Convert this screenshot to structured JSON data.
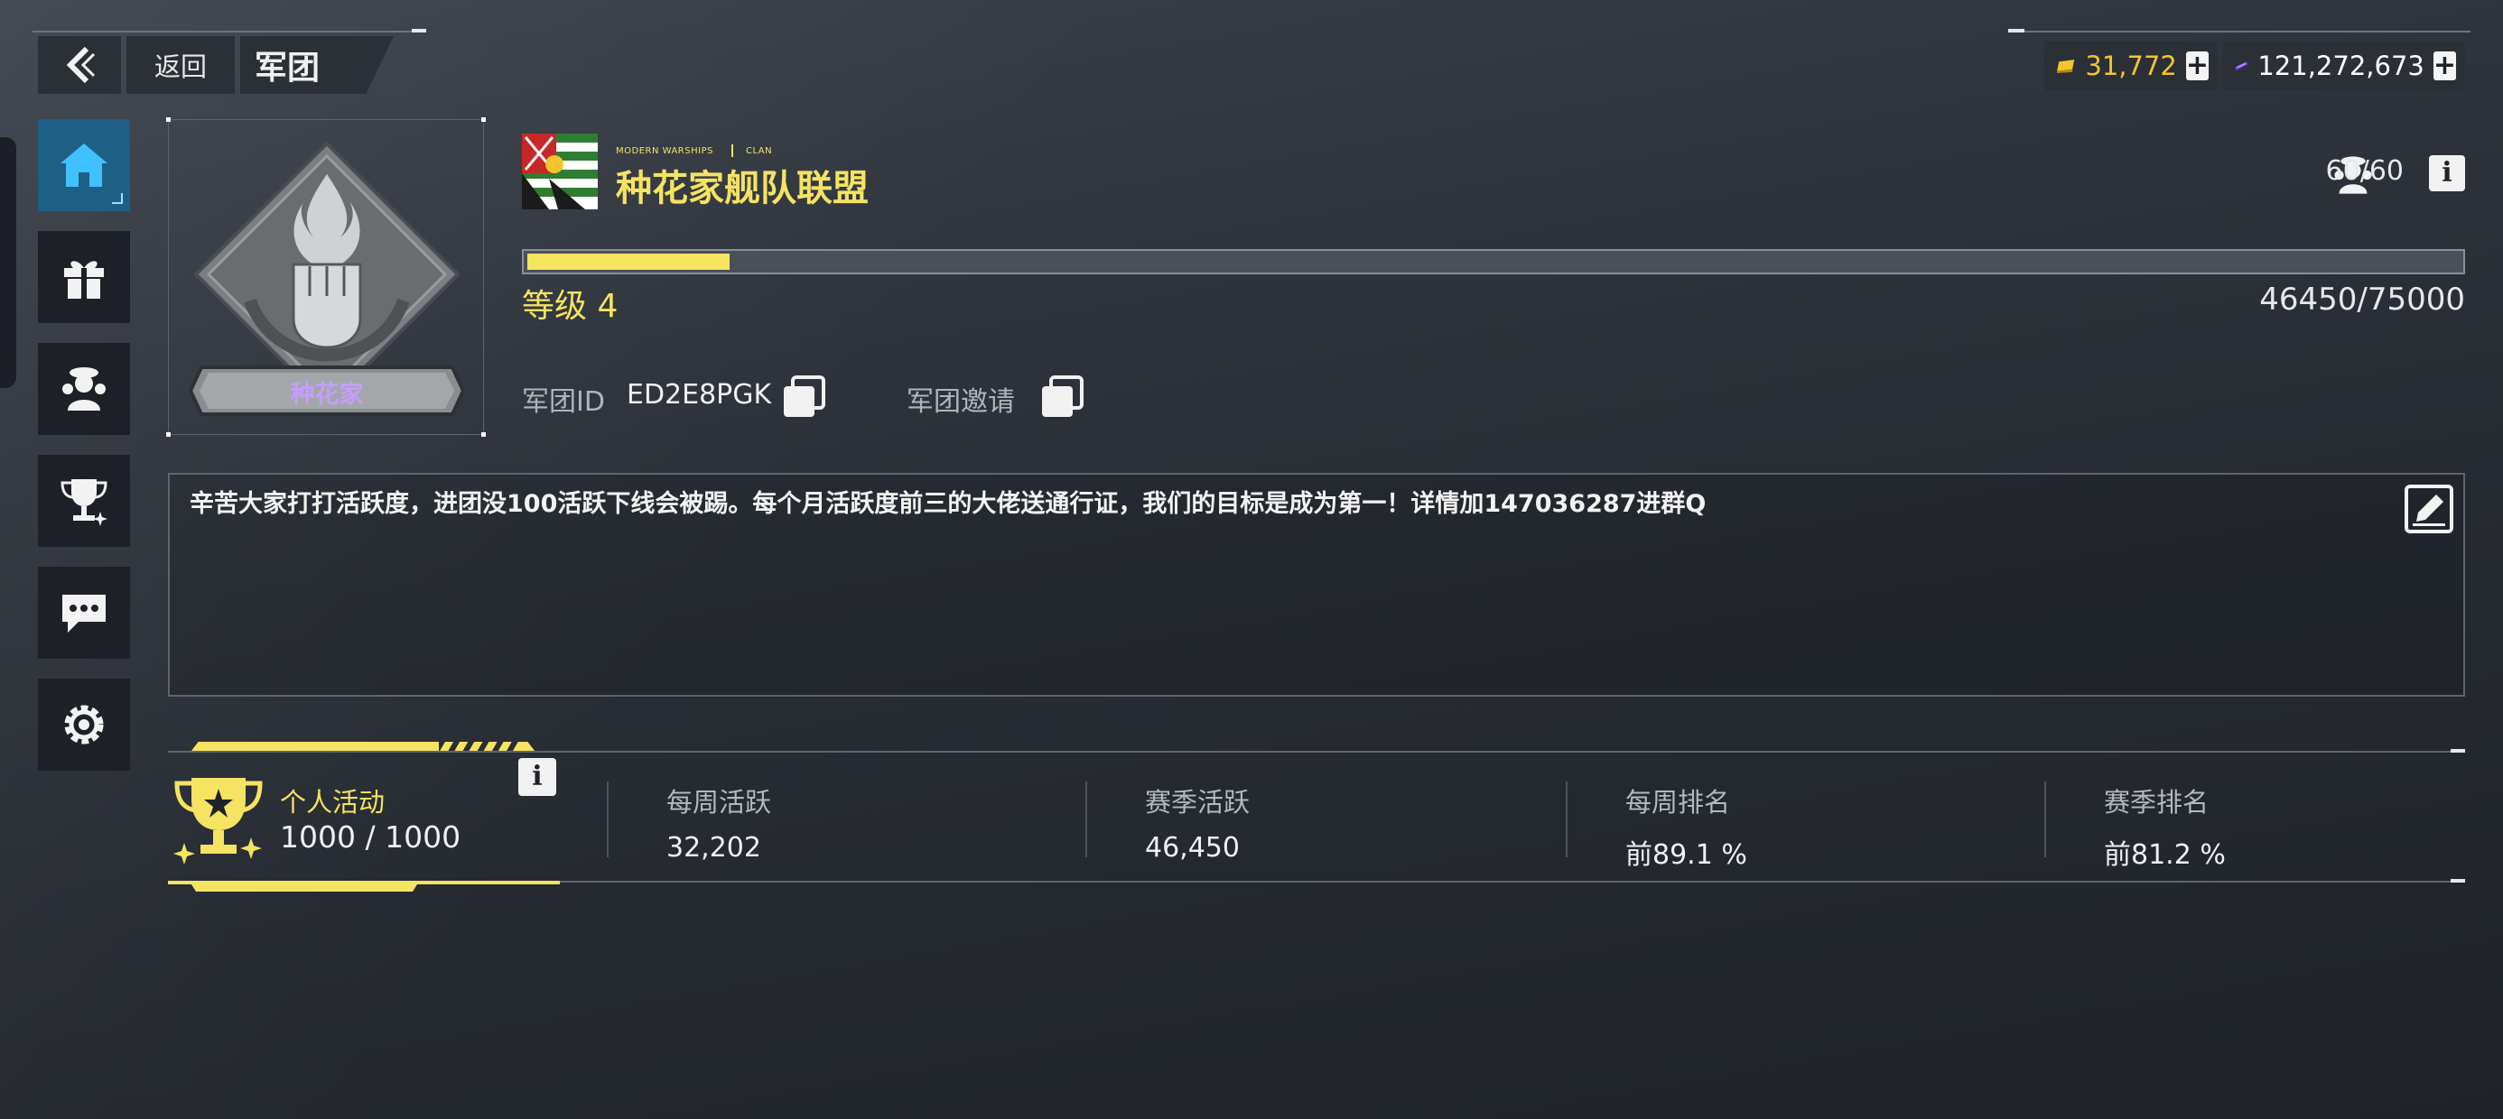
{
  "nav": {
    "back_label": "返回",
    "title": "军团"
  },
  "currencies": [
    {
      "icon": "gold-bar-icon",
      "value": "31,772",
      "color": "#f4c430"
    },
    {
      "icon": "purple-ticket-icon",
      "value": "121,272,673",
      "color": "#ffffff"
    }
  ],
  "sidebar": {
    "items": [
      {
        "icon": "home-icon",
        "active": true
      },
      {
        "icon": "gift-icon",
        "active": false
      },
      {
        "icon": "members-icon",
        "active": false
      },
      {
        "icon": "trophy-icon",
        "active": false
      },
      {
        "icon": "chat-icon",
        "active": false
      },
      {
        "icon": "settings-icon",
        "active": false
      }
    ]
  },
  "clan": {
    "badge_name": "种花家",
    "tag_game": "MODERN WARSHIPS",
    "tag_clan": "CLAN",
    "name": "种花家舰队联盟",
    "members": "60/60",
    "level_text": "等级 4",
    "xp_text": "46450/75000",
    "xp_fraction": 0.1045,
    "id_label": "军团ID",
    "id_value": "ED2E8PGK",
    "invite_label": "军团邀请",
    "description": "辛苦大家打打活跃度，进团没100活跃下线会被踢。每个月活跃度前三的大佬送通行证，我们的目标是成为第一！详情加147036287进群Q"
  },
  "stats": {
    "personal_label": "个人活动",
    "personal_value": "1000 / 1000",
    "items": [
      {
        "label": "每周活跃",
        "value": "32,202"
      },
      {
        "label": "赛季活跃",
        "value": "46,450"
      },
      {
        "label": "每周排名",
        "value": "前89.1 %"
      },
      {
        "label": "赛季排名",
        "value": "前81.2 %"
      }
    ]
  },
  "colors": {
    "accent_yellow": "#f5e362",
    "active_blue": "#1e5f86",
    "badge_purple": "#c79cff"
  }
}
